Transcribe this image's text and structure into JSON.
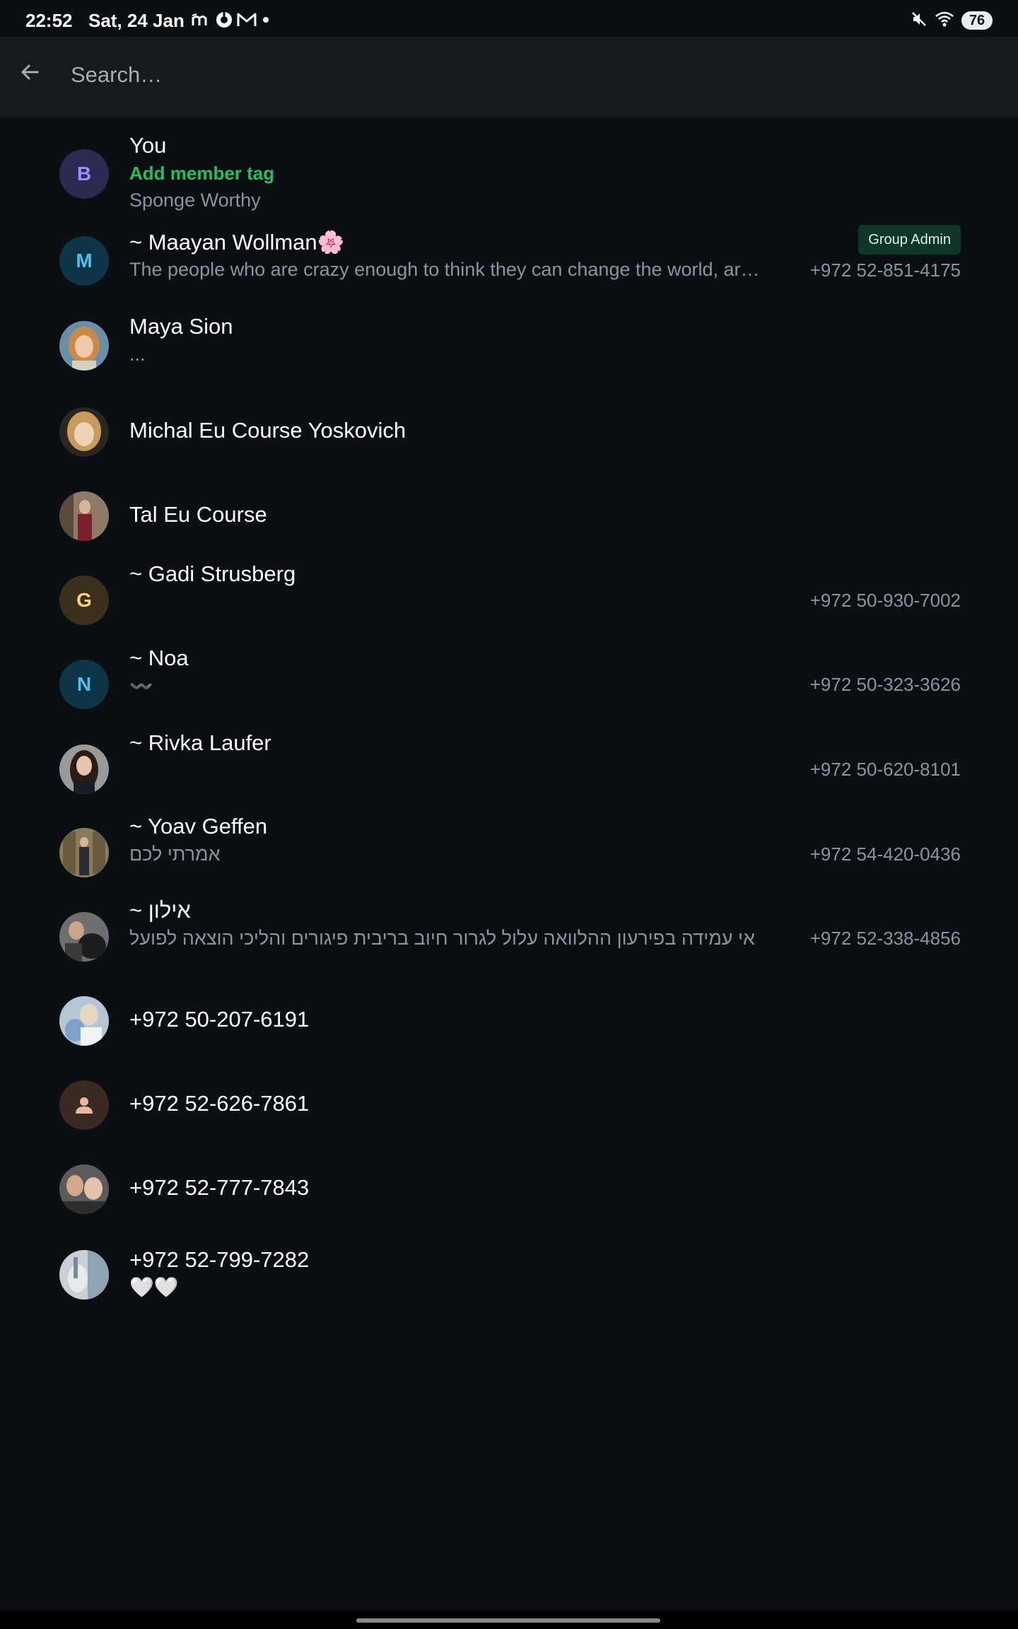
{
  "status_bar": {
    "time": "22:52",
    "date": "Sat, 24 Jan",
    "battery": "76",
    "notification_icons": [
      "app-m-icon",
      "sync-icon",
      "gmail-icon",
      "dot-icon"
    ],
    "system_icons": [
      "mute-icon",
      "wifi-icon",
      "battery-icon"
    ]
  },
  "search": {
    "placeholder": "Search…",
    "value": ""
  },
  "colors": {
    "background": "#0b0f14",
    "header": "#161a1e",
    "accent_green": "#21c063",
    "badge_bg": "#103529",
    "secondary_text": "#8a949b"
  },
  "members": [
    {
      "name": "You",
      "tag": "Add member tag",
      "subtitle": "Sponge Worthy",
      "avatar": {
        "type": "letter",
        "letter": "B",
        "bg": "#2b2b52",
        "fg": "#9a8fff"
      }
    },
    {
      "name": "~ Maayan Wollman🌸",
      "subtitle": "The people who are crazy enough to think they can change the world, ar…",
      "phone": "+972 52-851-4175",
      "badge": "Group Admin",
      "avatar": {
        "type": "letter",
        "letter": "M",
        "bg": "#0d3447",
        "fg": "#53bdeb"
      }
    },
    {
      "name": "Maya Sion",
      "subtitle": "...",
      "avatar": {
        "type": "photo",
        "icon": "profile-photo-icon"
      }
    },
    {
      "name": "Michal Eu Course Yoskovich",
      "avatar": {
        "type": "photo",
        "icon": "profile-photo-icon"
      }
    },
    {
      "name": "Tal Eu Course",
      "avatar": {
        "type": "photo",
        "icon": "profile-photo-icon"
      }
    },
    {
      "name": "~ Gadi Strusberg",
      "phone": "+972 50-930-7002",
      "avatar": {
        "type": "letter",
        "letter": "G",
        "bg": "#3b2f1d",
        "fg": "#ffd279"
      }
    },
    {
      "name": "~ Noa",
      "subtitle": "〰️",
      "phone": "+972 50-323-3626",
      "avatar": {
        "type": "letter",
        "letter": "N",
        "bg": "#0d3447",
        "fg": "#53bdeb"
      }
    },
    {
      "name": "~ Rivka Laufer",
      "phone": "+972 50-620-8101",
      "avatar": {
        "type": "photo",
        "icon": "profile-photo-icon"
      }
    },
    {
      "name": "~ Yoav Geffen",
      "subtitle": "אמרתי לכם",
      "phone": "+972 54-420-0436",
      "avatar": {
        "type": "photo",
        "icon": "profile-photo-icon"
      }
    },
    {
      "name": "~ אילון",
      "subtitle": "אי עמידה בפירעון ההלוואה עלול לגרור חיוב בריבית פיגורים והליכי הוצאה לפועל",
      "phone": "+972 52-338-4856",
      "avatar": {
        "type": "photo",
        "icon": "profile-photo-icon"
      }
    },
    {
      "name": "+972 50-207-6191",
      "avatar": {
        "type": "photo",
        "icon": "profile-photo-icon"
      }
    },
    {
      "name": "+972 52-626-7861",
      "avatar": {
        "type": "default",
        "icon": "person-icon",
        "bg": "#3b2a22",
        "fg": "#e8b8a0"
      }
    },
    {
      "name": "+972 52-777-7843",
      "avatar": {
        "type": "photo",
        "icon": "profile-photo-icon"
      }
    },
    {
      "name": "+972 52-799-7282",
      "subtitle": "🤍🤍",
      "avatar": {
        "type": "photo",
        "icon": "profile-photo-icon"
      }
    }
  ]
}
